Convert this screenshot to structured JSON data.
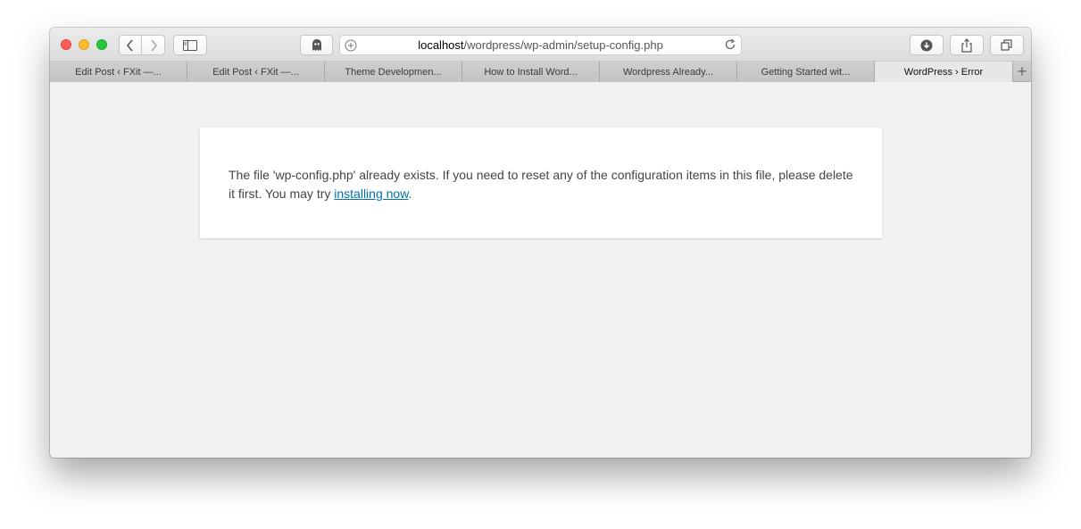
{
  "browser": {
    "address": {
      "host": "localhost",
      "path": "/wordpress/wp-admin/setup-config.php"
    },
    "tabs": [
      {
        "label": "Edit Post ‹ FXit —..."
      },
      {
        "label": "Edit Post ‹ FXit —..."
      },
      {
        "label": "Theme Developmen..."
      },
      {
        "label": "How to Install Word..."
      },
      {
        "label": "Wordpress Already..."
      },
      {
        "label": "Getting Started wit..."
      },
      {
        "label": "WordPress › Error"
      }
    ],
    "new_tab_label": "+"
  },
  "page": {
    "message_before": "The file 'wp-config.php' already exists. If you need to reset any of the configuration items in this file, please delete it first. You may try ",
    "link_text": "installing now",
    "message_after": "."
  },
  "colors": {
    "link": "#0073aa",
    "background": "#f1f1f1"
  }
}
